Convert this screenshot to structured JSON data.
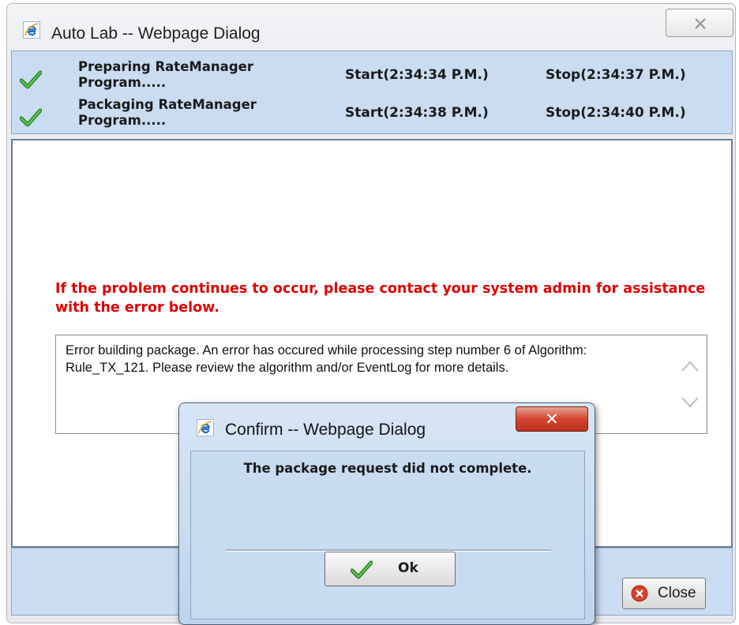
{
  "main_dialog": {
    "title": "Auto Lab -- Webpage Dialog",
    "steps": [
      {
        "label": "Preparing RateManager Program.....",
        "start": "Start(2:34:34 P.M.)",
        "stop": "Stop(2:34:37 P.M.)"
      },
      {
        "label": "Packaging RateManager Program.....",
        "start": "Start(2:34:38 P.M.)",
        "stop": "Stop(2:34:40 P.M.)"
      }
    ],
    "error_headline": "If the problem continues to occur, please contact your system admin for assistance with the error below.",
    "error_detail": "Error building package.  An error has occured while processing step number 6 of Algorithm: Rule_TX_121.  Please review the algorithm and/or EventLog for more details.",
    "close_label": "Close"
  },
  "confirm_dialog": {
    "title": "Confirm -- Webpage Dialog",
    "message": "The package request did not complete.",
    "ok_label": "Ok"
  },
  "colors": {
    "error_text": "#e00000",
    "panel_blue": "#c9dcf2",
    "close_red": "#d2452f",
    "check_green": "#2e9a2e"
  },
  "icons": {
    "window": "internet-explorer-icon",
    "step_status": "green-check-icon",
    "close_button": "red-circle-x-icon"
  }
}
